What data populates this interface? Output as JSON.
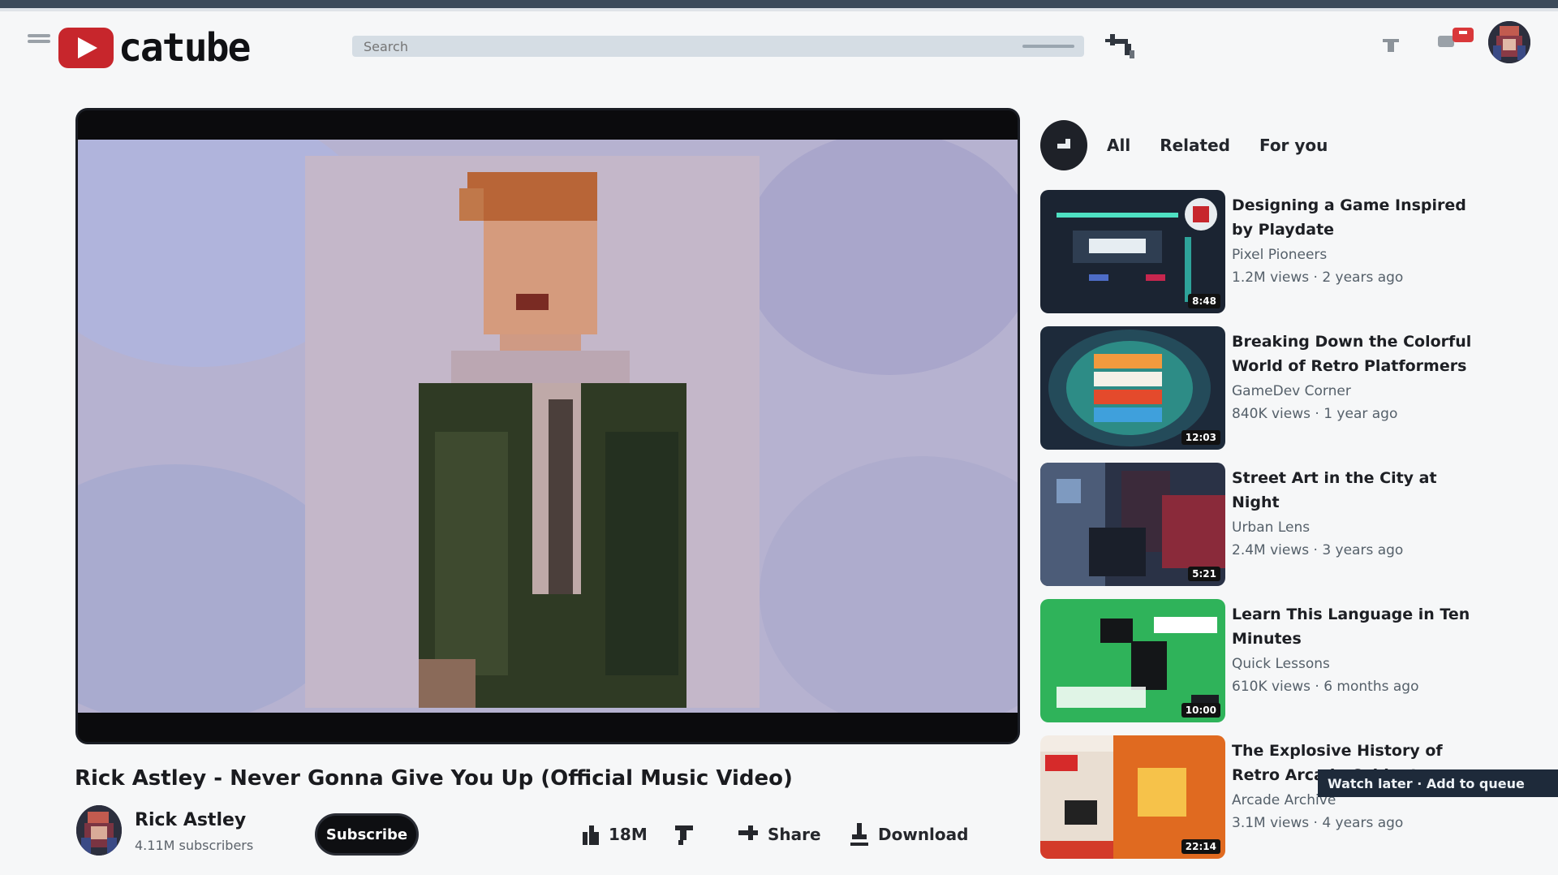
{
  "app": {
    "logo_text": "catube",
    "brand_color": "#c7262c"
  },
  "header": {
    "search_placeholder": "Search",
    "icons": [
      "menu-icon",
      "search-icon",
      "cast-icon",
      "notifications-icon"
    ]
  },
  "video": {
    "title": "Rick Astley - Never Gonna Give You Up (Official Music Video)",
    "channel_name": "Rick Astley",
    "channel_subs": "4.11M subscribers",
    "subscribe_label": "Subscribe",
    "actions": {
      "like_count": "18M",
      "share_label": "Share",
      "download_label": "Download"
    }
  },
  "sidebar": {
    "chips": [
      "All",
      "Related",
      "For you"
    ],
    "recommendations": [
      {
        "title": "Designing a Game Inspired by Playdate",
        "channel": "Pixel Pioneers",
        "meta": "1.2M views · 2 years ago",
        "duration": "8:48"
      },
      {
        "title": "Breaking Down the Colorful World of Retro Platformers",
        "channel": "GameDev Corner",
        "meta": "840K views · 1 year ago",
        "duration": "12:03"
      },
      {
        "title": "Street Art in the City at Night",
        "channel": "Urban Lens",
        "meta": "2.4M views · 3 years ago",
        "duration": "5:21"
      },
      {
        "title": "Learn This Language in Ten Minutes",
        "channel": "Quick Lessons",
        "meta": "610K views · 6 months ago",
        "duration": "10:00"
      },
      {
        "title": "The Explosive History of Retro Arcade Cabinets",
        "channel": "Arcade Archive",
        "meta": "3.1M views · 4 years ago",
        "duration": "22:14"
      }
    ]
  },
  "tooltip": {
    "text": "Watch later · Add to queue"
  }
}
